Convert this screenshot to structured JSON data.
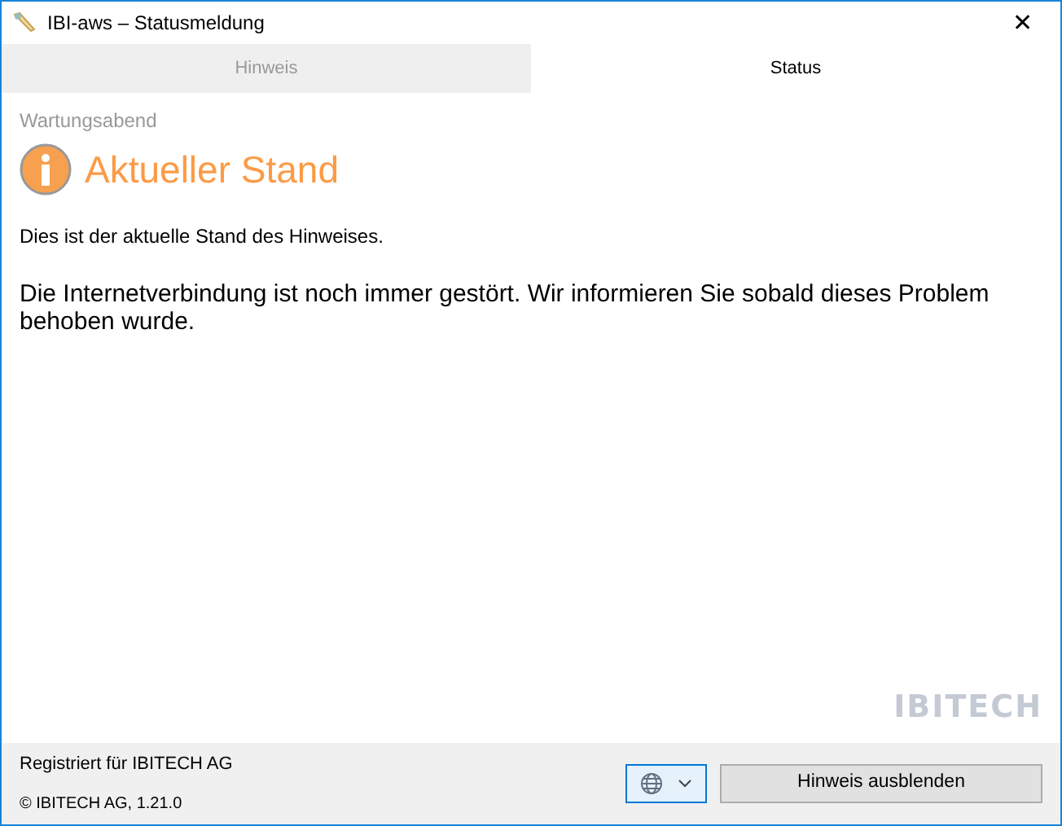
{
  "window": {
    "title": "IBI-aws – Statusmeldung",
    "close": "✕"
  },
  "tabs": [
    {
      "label": "Hinweis",
      "selected": false
    },
    {
      "label": "Status",
      "selected": true
    }
  ],
  "category": "Wartungsabend",
  "heading": "Aktueller Stand",
  "intro": "Dies ist der aktuelle Stand des Hinweises.",
  "message": "Die Internetverbindung ist noch immer gestört. Wir informieren Sie sobald dieses Problem behoben wurde.",
  "logo": "IBITECH",
  "footer": {
    "registered": "Registriert für IBITECH AG",
    "copyright": "© IBITECH AG, 1.21.0",
    "button": "Hinweis ausblenden"
  }
}
